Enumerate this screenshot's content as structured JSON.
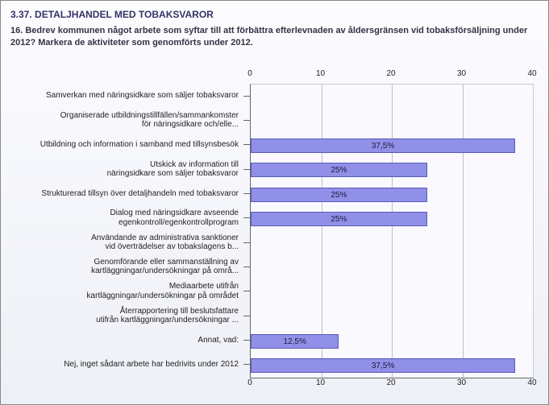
{
  "section_title": "3.37. DETALJHANDEL MED TOBAKSVAROR",
  "question": "16. Bedrev kommunen något arbete som syftar till att förbättra efterlevnaden av åldersgränsen vid tobaksförsäljning under 2012? Markera de aktiviteter som genomförts under 2012.",
  "axis": {
    "min": 0,
    "max": 40,
    "ticks": [
      "0",
      "10",
      "20",
      "30",
      "40"
    ]
  },
  "rows": [
    {
      "label": "Samverkan med näringsidkare som säljer tobaksvaror",
      "value": 0,
      "display": ""
    },
    {
      "label": "Organiserade utbildningstillfällen/sammankomster\nför näringsidkare och/elle...",
      "value": 0,
      "display": ""
    },
    {
      "label": "Utbildning och information i samband med tillsynsbesök",
      "value": 37.5,
      "display": "37,5%"
    },
    {
      "label": "Utskick av information till\nnäringsidkare som säljer tobaksvaror",
      "value": 25,
      "display": "25%"
    },
    {
      "label": "Strukturerad tillsyn över detaljhandeln med tobaksvaror",
      "value": 25,
      "display": "25%"
    },
    {
      "label": "Dialog med näringsidkare avseende\negenkontroll/egenkontrollprogram",
      "value": 25,
      "display": "25%"
    },
    {
      "label": "Användande av administrativa sanktioner\nvid överträdelser av tobakslagens b...",
      "value": 0,
      "display": ""
    },
    {
      "label": "Genomförande eller sammanställning av\nkartläggningar/undersökningar på områ...",
      "value": 0,
      "display": ""
    },
    {
      "label": "Mediaarbete utifrån\nkartläggningar/undersökningar på området",
      "value": 0,
      "display": ""
    },
    {
      "label": "Återrapportering till beslutsfattare\nutifrån kartläggningar/undersökningar ...",
      "value": 0,
      "display": ""
    },
    {
      "label": "Annat, vad:",
      "value": 12.5,
      "display": "12,5%"
    },
    {
      "label": "Nej, inget sådant arbete har bedrivits under 2012",
      "value": 37.5,
      "display": "37,5%"
    }
  ],
  "chart_data": {
    "type": "bar",
    "orientation": "horizontal",
    "title": "",
    "xlabel": "",
    "ylabel": "",
    "xlim": [
      0,
      40
    ],
    "categories": [
      "Samverkan med näringsidkare som säljer tobaksvaror",
      "Organiserade utbildningstillfällen/sammankomster för näringsidkare och/elle...",
      "Utbildning och information i samband med tillsynsbesök",
      "Utskick av information till näringsidkare som säljer tobaksvaror",
      "Strukturerad tillsyn över detaljhandeln med tobaksvaror",
      "Dialog med näringsidkare avseende egenkontroll/egenkontrollprogram",
      "Användande av administrativa sanktioner vid överträdelser av tobakslagens b...",
      "Genomförande eller sammanställning av kartläggningar/undersökningar på områ...",
      "Mediaarbete utifrån kartläggningar/undersökningar på området",
      "Återrapportering till beslutsfattare utifrån kartläggningar/undersökningar ...",
      "Annat, vad:",
      "Nej, inget sådant arbete har bedrivits under 2012"
    ],
    "values": [
      0,
      0,
      37.5,
      25,
      25,
      25,
      0,
      0,
      0,
      0,
      12.5,
      37.5
    ],
    "value_labels": [
      "",
      "",
      "37,5%",
      "25%",
      "25%",
      "25%",
      "",
      "",
      "",
      "",
      "12,5%",
      "37,5%"
    ]
  }
}
